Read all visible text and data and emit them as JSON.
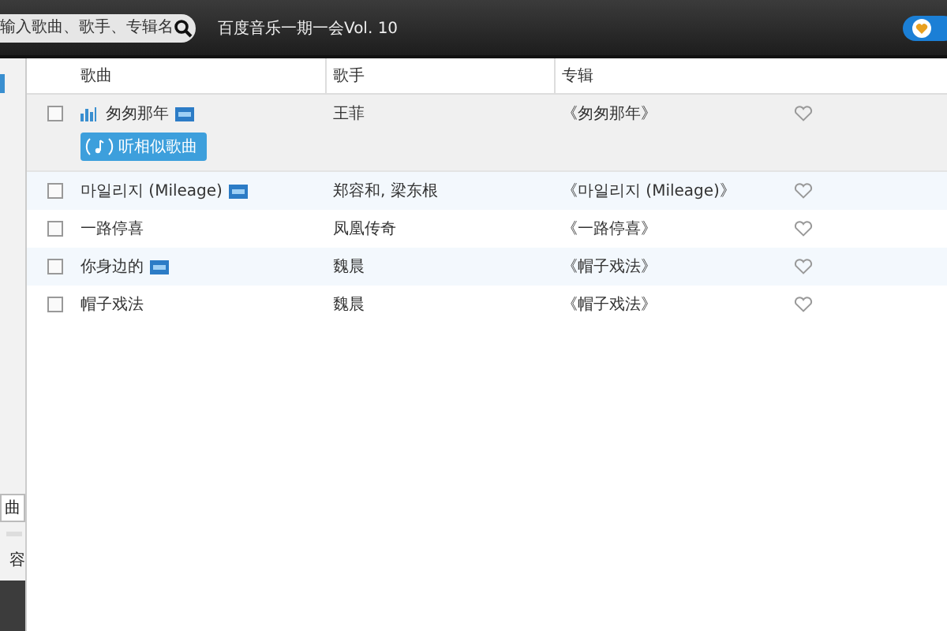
{
  "toolbar": {
    "search": {
      "placeholder": "输入歌曲、歌手、专辑名"
    },
    "title": "百度音乐一期一会Vol. 10"
  },
  "sidebar": {
    "button_label": "曲",
    "bottom_label": "容"
  },
  "table": {
    "columns": [
      "歌曲",
      "歌手",
      "专辑"
    ],
    "rows": [
      {
        "title": "匆匆那年",
        "artist": "王菲",
        "album": "《匆匆那年》",
        "mv": true,
        "playing": true,
        "expanded": true,
        "checked": false,
        "similar_button": "听相似歌曲"
      },
      {
        "title": "마일리지 (Mileage)",
        "artist": "郑容和, 梁东根",
        "album": "《마일리지 (Mileage)》",
        "mv": true,
        "playing": false,
        "expanded": false,
        "checked": false
      },
      {
        "title": "一路停喜",
        "artist": "凤凰传奇",
        "album": "《一路停喜》",
        "mv": false,
        "playing": false,
        "expanded": false,
        "checked": false
      },
      {
        "title": "你身边的",
        "artist": "魏晨",
        "album": "《帽子戏法》",
        "mv": true,
        "playing": false,
        "expanded": false,
        "checked": false
      },
      {
        "title": "帽子戏法",
        "artist": "魏晨",
        "album": "《帽子戏法》",
        "mv": false,
        "playing": false,
        "expanded": false,
        "checked": false
      }
    ]
  }
}
